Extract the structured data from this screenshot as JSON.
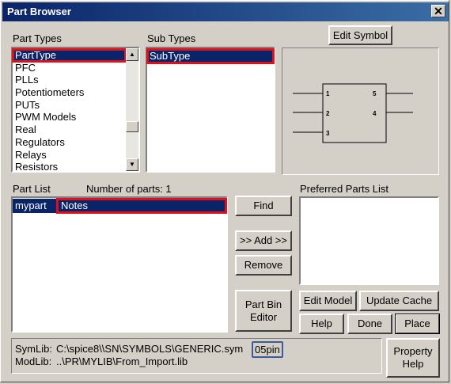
{
  "window": {
    "title": "Part Browser",
    "close_glyph": "✕"
  },
  "part_types": {
    "label": "Part Types",
    "items": [
      "PartType",
      "PFC",
      "PLLs",
      "Potentiometers",
      "PUTs",
      "PWM Models",
      "Real",
      "Regulators",
      "Relays",
      "Resistors"
    ],
    "selected": "PartType"
  },
  "sub_types": {
    "label": "Sub Types",
    "items": [
      "SubType"
    ],
    "selected": "SubType"
  },
  "symbol_preview": {
    "pins": [
      "1",
      "2",
      "3",
      "5",
      "4"
    ]
  },
  "buttons": {
    "edit_symbol": "Edit Symbol",
    "find": "Find",
    "add": ">> Add >>",
    "remove": "Remove",
    "part_bin_editor_line1": "Part Bin",
    "part_bin_editor_line2": "Editor",
    "edit_model": "Edit Model",
    "update_cache": "Update  Cache",
    "help": "Help",
    "done": "Done",
    "place": "Place",
    "property_help_line1": "Property",
    "property_help_line2": "Help"
  },
  "part_list": {
    "label": "Part List",
    "count_label": "Number of parts: 1",
    "rows": [
      {
        "name": "mypart",
        "description": "Notes"
      }
    ]
  },
  "preferred_parts": {
    "label": "Preferred Parts List",
    "items": []
  },
  "libs": {
    "symlib_label": "SymLib:",
    "symlib_path": "C:\\spice8\\\\SN\\SYMBOLS\\GENERIC.sym",
    "symlib_symbol": "05pin",
    "modlib_label": "ModLib:",
    "modlib_path": "..\\PR\\MYLIB\\From_Import.lib"
  },
  "colors": {
    "selection": "#0a246a",
    "highlight": "#e0101a",
    "face": "#d4d0c8"
  }
}
